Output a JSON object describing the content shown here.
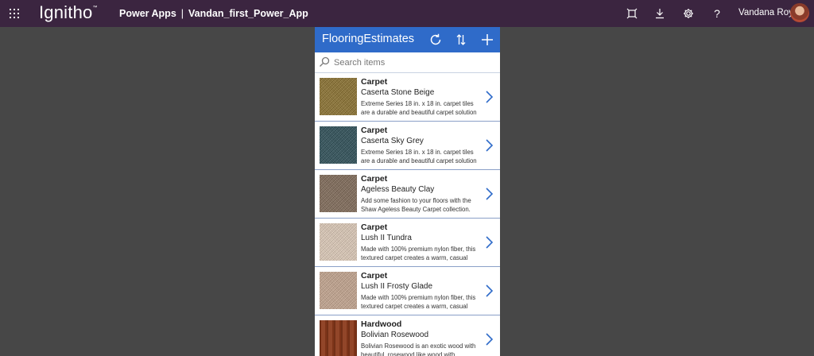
{
  "topbar": {
    "brand": "Ignitho",
    "brand_mark": "™",
    "product": "Power Apps",
    "separator": "|",
    "app_name": "Vandan_first_Power_App",
    "user_name": "Vandana Roy",
    "icons": [
      "waffle-icon",
      "fit-screen-icon",
      "download-icon",
      "gear-icon",
      "help-icon"
    ],
    "help_glyph": "?",
    "bg_color": "#3b2540"
  },
  "app": {
    "title": "FlooringEstimates",
    "header_color": "#2f6bc9",
    "header_icons": [
      "refresh-icon",
      "sort-icon",
      "add-icon"
    ],
    "search": {
      "placeholder": "Search items",
      "value": ""
    },
    "items": [
      {
        "category": "Carpet",
        "name": "Caserta Stone Beige",
        "description": "Extreme Series 18 in. x 18 in. carpet tiles are a durable and beautiful carpet solution specially engineered for both",
        "swatch": "#8a7130"
      },
      {
        "category": "Carpet",
        "name": "Caserta Sky Grey",
        "description": "Extreme Series 18 in. x 18 in. carpet tiles are a durable and beautiful carpet solution specially engineered for both",
        "swatch": "#2e4f57"
      },
      {
        "category": "Carpet",
        "name": "Ageless Beauty Clay",
        "description": "Add some fashion to your floors with the Shaw Ageless Beauty Carpet collection.",
        "swatch": "#7f6a58"
      },
      {
        "category": "Carpet",
        "name": "Lush II Tundra",
        "description": "Made with 100% premium nylon fiber, this textured carpet creates a warm, casual atmosphere that invites you to",
        "swatch": "#dcc9b7"
      },
      {
        "category": "Carpet",
        "name": "Lush II Frosty Glade",
        "description": "Made with 100% premium nylon fiber, this textured carpet creates a warm, casual atmosphere that invites you to",
        "swatch": "#c2a48e"
      },
      {
        "category": "Hardwood",
        "name": "Bolivian Rosewood",
        "description": "Bolivian Rosewood is an exotic wood with beautiful, rosewood like wood with",
        "swatch": "#8b3a1c"
      }
    ]
  }
}
